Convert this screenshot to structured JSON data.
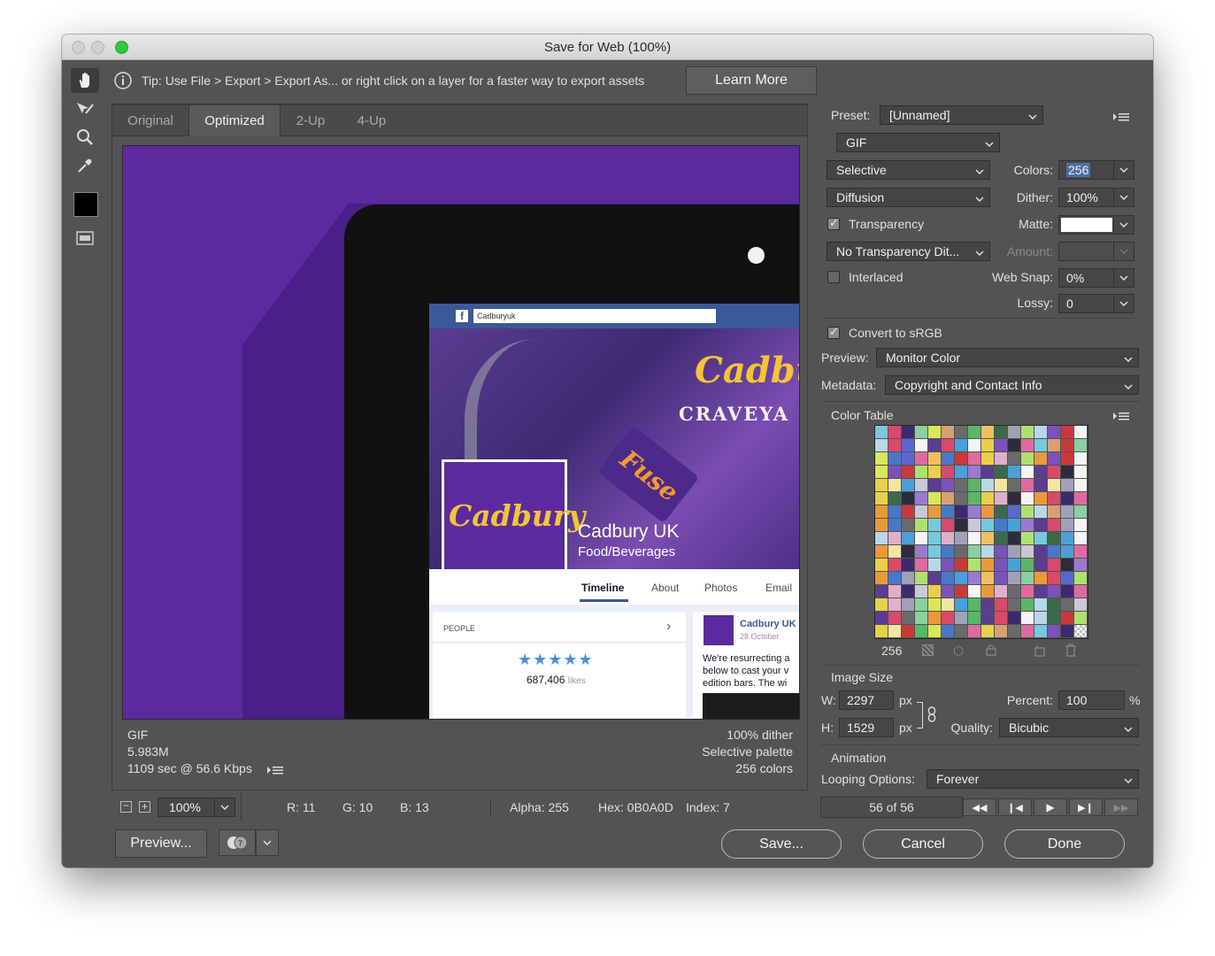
{
  "window": {
    "title": "Save for Web (100%)"
  },
  "tip": {
    "text": "Tip: Use File > Export > Export As...  or right click on a layer for a faster way to export assets",
    "learn_more": "Learn More"
  },
  "tabs": [
    {
      "label": "Original"
    },
    {
      "label": "Optimized"
    },
    {
      "label": "2-Up"
    },
    {
      "label": "4-Up"
    }
  ],
  "preview_image": {
    "search_text": "Cadburyuk",
    "page_name": "Cadbury UK",
    "category": "Food/Beverages",
    "brand_logo": "Cadbury",
    "banner_title": "CRAVEYA",
    "product": "Fuse",
    "nav": [
      "Timeline",
      "About",
      "Photos",
      "Email"
    ],
    "people_label": "PEOPLE",
    "likes_count": "687,406",
    "likes_label": "likes",
    "post_author": "Cadbury UK",
    "post_date": "28 October",
    "post_text": [
      "We're resurrecting a",
      "below to cast your v",
      "edition bars. The wi"
    ]
  },
  "image_info": {
    "format": "GIF",
    "size": "5.983M",
    "time": "1109 sec @ 56.6 Kbps",
    "dither": "100% dither",
    "palette": "Selective palette",
    "colors": "256 colors"
  },
  "status": {
    "zoom": "100%",
    "r": "R: 11",
    "g": "G: 10",
    "b": "B: 13",
    "alpha": "Alpha: 255",
    "hex": "Hex: 0B0A0D",
    "index": "Index: 7"
  },
  "bottom": {
    "preview": "Preview...",
    "save": "Save...",
    "cancel": "Cancel",
    "done": "Done"
  },
  "settings": {
    "preset_label": "Preset:",
    "preset": "[Unnamed]",
    "format": "GIF",
    "reduction": "Selective",
    "colors_label": "Colors:",
    "colors": "256",
    "dither_algo": "Diffusion",
    "dither_label": "Dither:",
    "dither": "100%",
    "transparency_label": "Transparency",
    "transparency": true,
    "matte_label": "Matte:",
    "transparency_dither": "No Transparency Dit...",
    "amount_label": "Amount:",
    "interlaced_label": "Interlaced",
    "interlaced": false,
    "websnap_label": "Web Snap:",
    "websnap": "0%",
    "lossy_label": "Lossy:",
    "lossy": "0",
    "srgb_label": "Convert to sRGB",
    "srgb": true,
    "preview_label": "Preview:",
    "preview": "Monitor Color",
    "metadata_label": "Metadata:",
    "metadata": "Copyright and Contact Info"
  },
  "color_table": {
    "title": "Color Table",
    "count": "256"
  },
  "image_size": {
    "title": "Image Size",
    "w_label": "W:",
    "w": "2297",
    "h_label": "H:",
    "h": "1529",
    "unit": "px",
    "percent_label": "Percent:",
    "percent": "100",
    "percent_unit": "%",
    "quality_label": "Quality:",
    "quality": "Bicubic"
  },
  "animation": {
    "title": "Animation",
    "looping_label": "Looping Options:",
    "looping": "Forever",
    "frame": "56 of 56"
  },
  "colors": {
    "accent": "#5b2a9e",
    "dialog_bg": "#535353",
    "selection": "#4b6ea8"
  }
}
